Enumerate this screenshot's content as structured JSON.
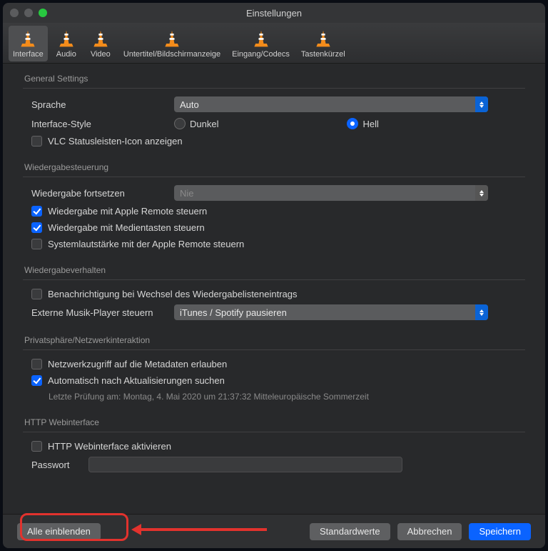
{
  "window": {
    "title": "Einstellungen"
  },
  "tabs": [
    {
      "label": "Interface"
    },
    {
      "label": "Audio"
    },
    {
      "label": "Video"
    },
    {
      "label": "Untertitel/Bildschirmanzeige"
    },
    {
      "label": "Eingang/Codecs"
    },
    {
      "label": "Tastenkürzel"
    }
  ],
  "general": {
    "title": "General Settings",
    "language_label": "Sprache",
    "language_value": "Auto",
    "style_label": "Interface-Style",
    "style_dark": "Dunkel",
    "style_light": "Hell",
    "status_icon": "VLC Statusleisten-Icon anzeigen"
  },
  "playback_ctrl": {
    "title": "Wiedergabesteuerung",
    "resume_label": "Wiedergabe fortsetzen",
    "resume_value": "Nie",
    "apple_remote": "Wiedergabe mit Apple Remote steuern",
    "media_keys": "Wiedergabe mit Medientasten steuern",
    "sys_vol": "Systemlautstärke mit der Apple Remote steuern"
  },
  "playback_beh": {
    "title": "Wiedergabeverhalten",
    "notify": "Benachrichtigung bei Wechsel des Wiedergabelisteneintrags",
    "ext_player_label": "Externe Musik-Player steuern",
    "ext_player_value": "iTunes / Spotify pausieren"
  },
  "privacy": {
    "title": "Privatsphäre/Netzwerkinteraktion",
    "meta": "Netzwerkzugriff auf die Metadaten erlauben",
    "updates": "Automatisch nach Aktualisierungen suchen",
    "last_check": "Letzte Prüfung am: Montag, 4. Mai 2020 um 21:37:32 Mitteleuropäische Sommerzeit"
  },
  "http": {
    "title": "HTTP Webinterface",
    "enable": "HTTP Webinterface aktivieren",
    "password_label": "Passwort"
  },
  "footer": {
    "show_all": "Alle einblenden",
    "defaults": "Standardwerte",
    "cancel": "Abbrechen",
    "save": "Speichern"
  }
}
